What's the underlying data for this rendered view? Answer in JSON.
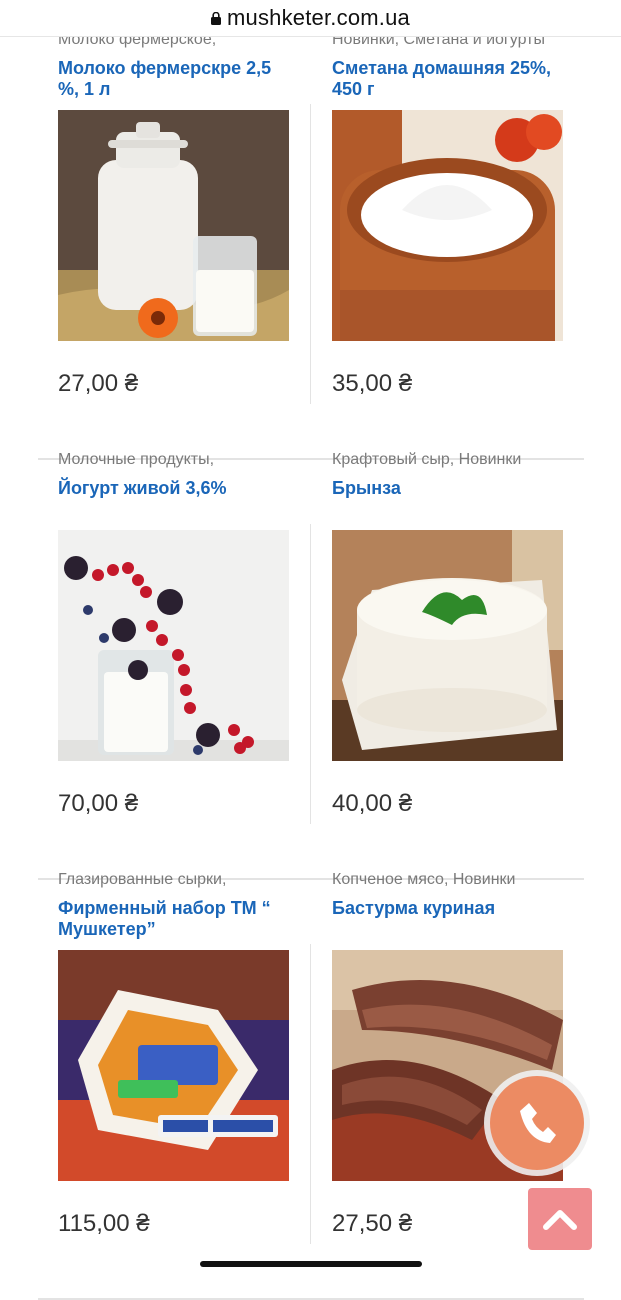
{
  "browser": {
    "domain": "mushketer.com.ua"
  },
  "products": [
    {
      "category": "Молоко фермерское,",
      "title": "Молоко фермерскре 2,5 %, 1 л",
      "price": "27,00 ₴"
    },
    {
      "category": "Новинки, Сметана и йогурты",
      "title": "Сметана домашняя 25%, 450 г",
      "price": "35,00 ₴"
    },
    {
      "category": "Молочные продукты,",
      "title": "Йогурт живой 3,6%",
      "price": "70,00 ₴"
    },
    {
      "category": "Крафтовый сыр, Новинки",
      "title": "Брынза",
      "price": "40,00 ₴"
    },
    {
      "category": "Глазированные сырки,",
      "title": "Фирменный набор ТМ “ Мушкетер”",
      "price": "115,00 ₴"
    },
    {
      "category": "Копченое мясо, Новинки",
      "title": "Бастурма куриная",
      "price": "27,50 ₴"
    }
  ],
  "icons": {
    "call": "phone-icon",
    "scroll_top": "chevron-up-icon",
    "lock": "lock-icon"
  },
  "colors": {
    "title": "#1a66b8",
    "call_button": "#ec8b63",
    "scroll_button": "#ef8c8f"
  }
}
